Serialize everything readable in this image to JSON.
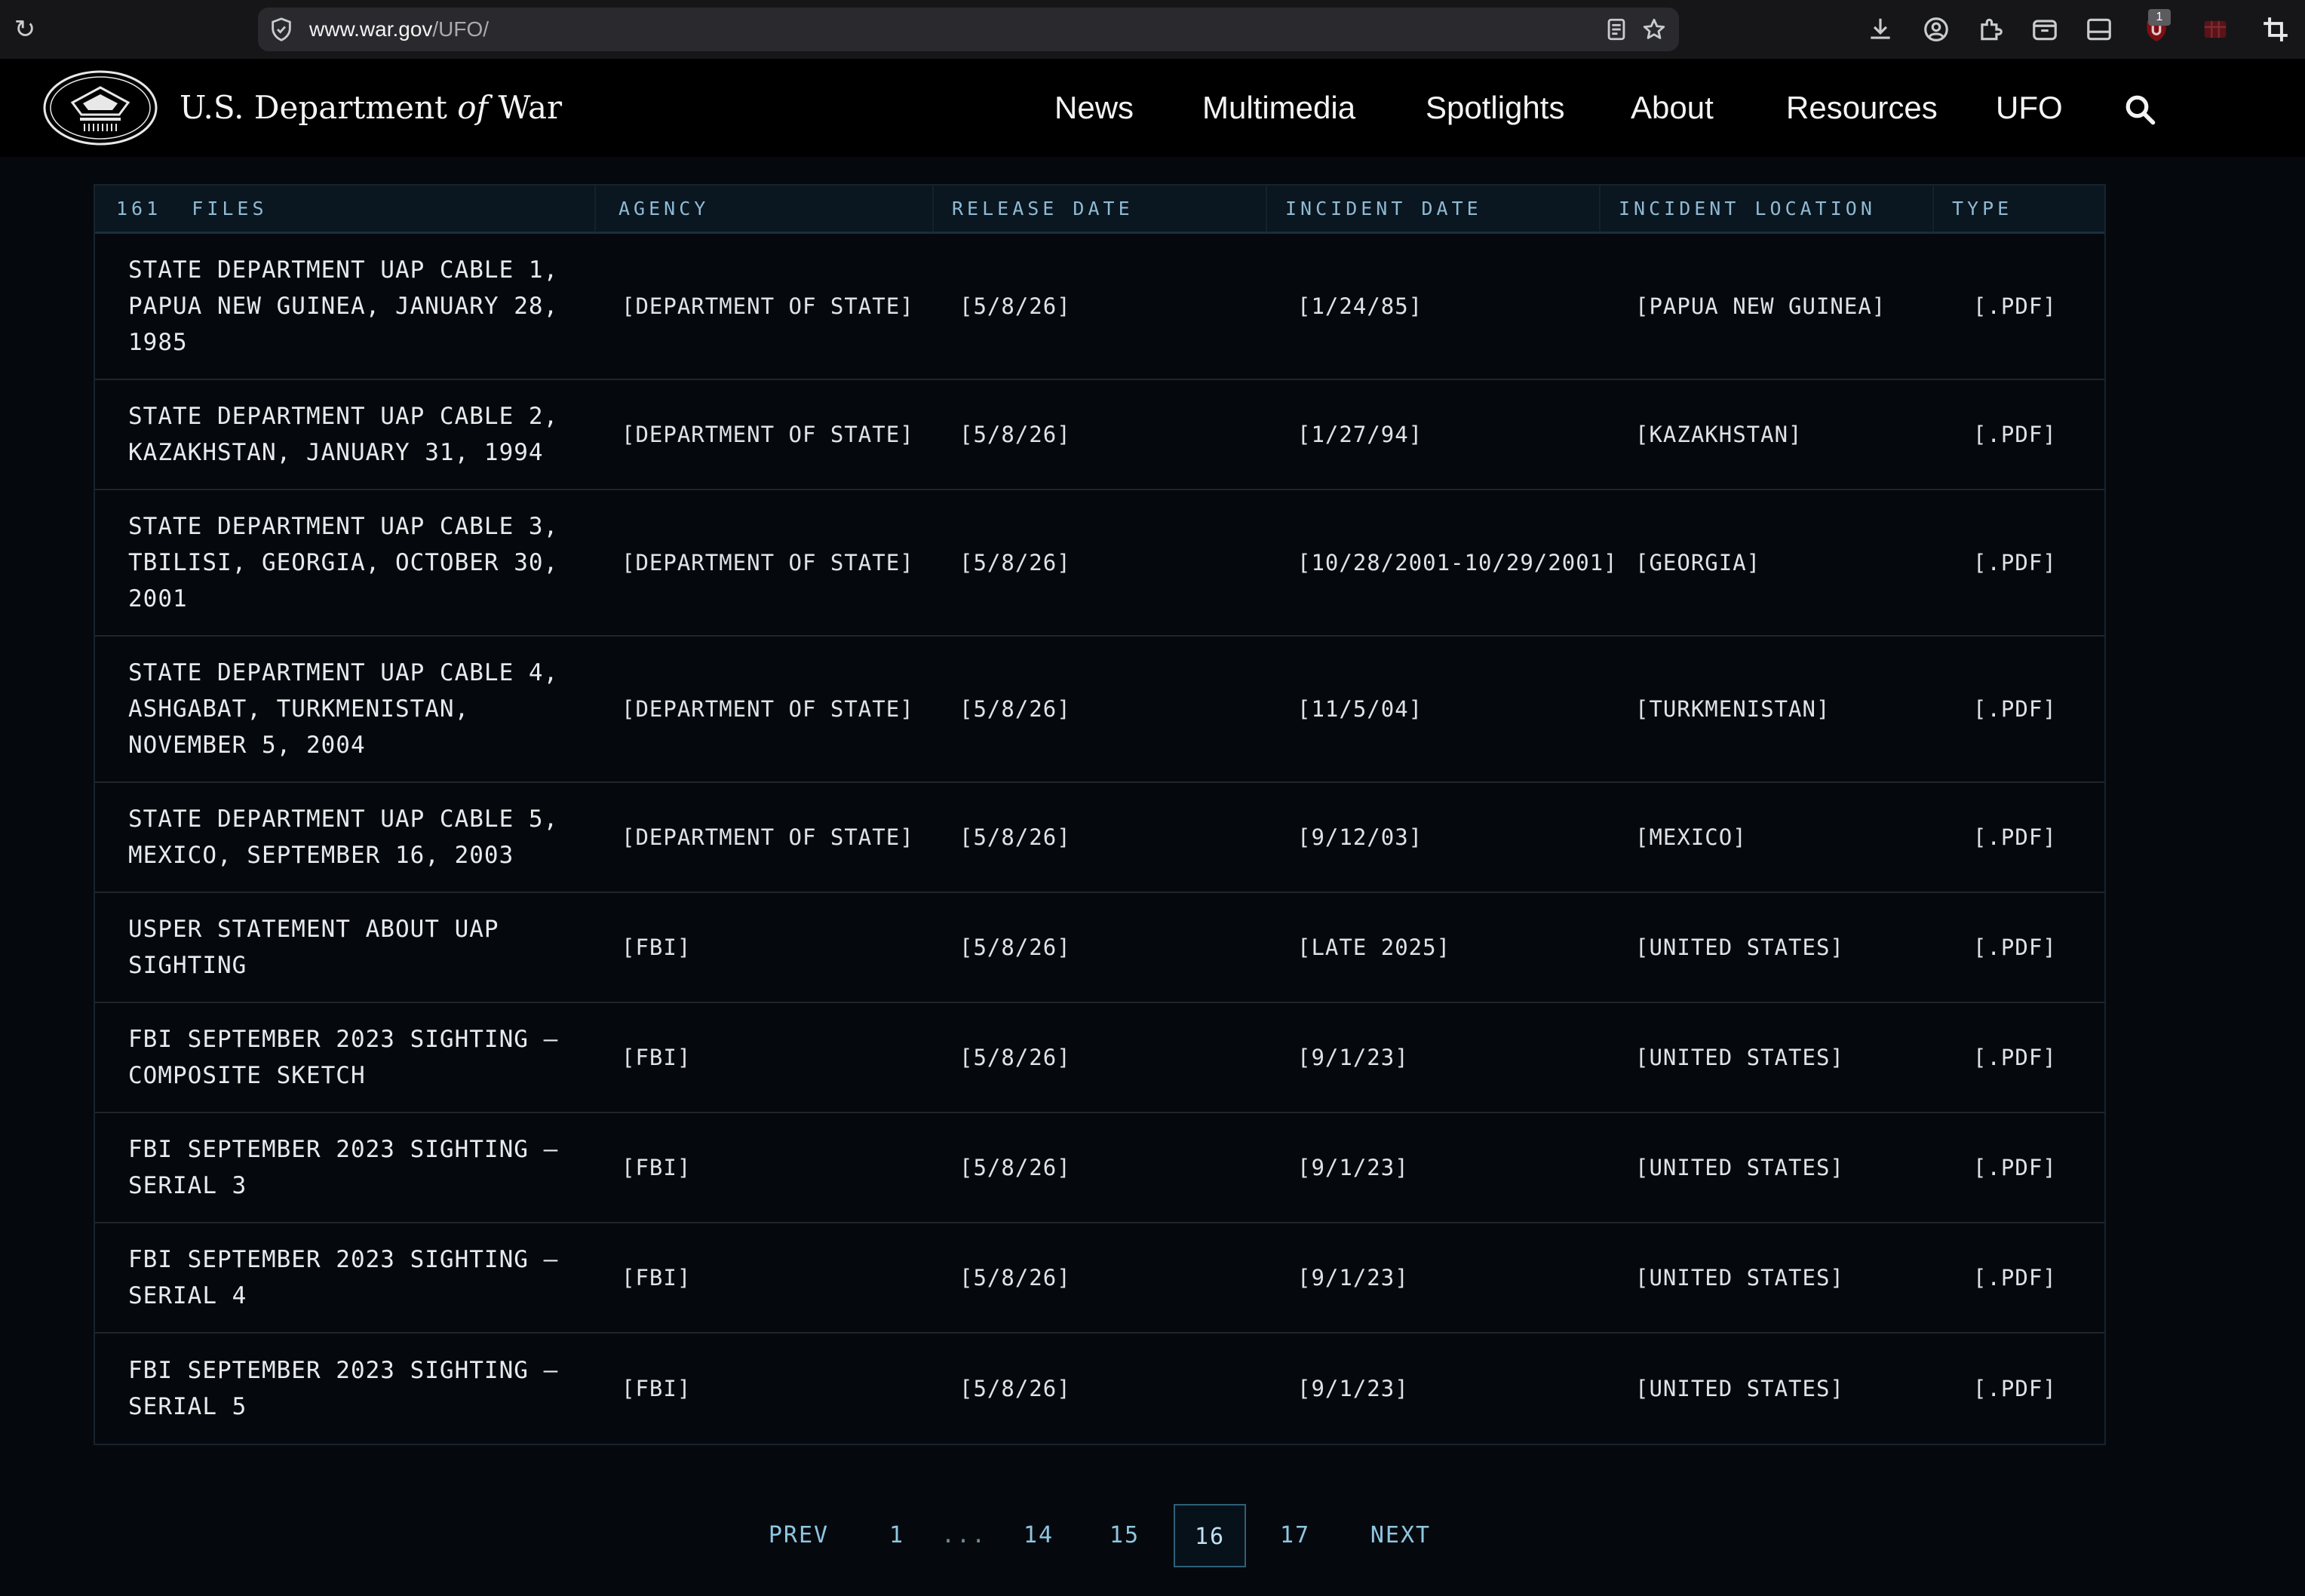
{
  "browser": {
    "url_host": "www.war.gov",
    "url_path": "/UFO/",
    "extension_badge": "1"
  },
  "site": {
    "title_part1": "U.S. Department ",
    "title_of": "of",
    "title_part2": " War",
    "nav": [
      "News",
      "Multimedia",
      "Spotlights",
      "About",
      "Resources",
      "UFO"
    ]
  },
  "table": {
    "headers": {
      "count": "161",
      "files": "FILES",
      "agency": "AGENCY",
      "release_date": "RELEASE DATE",
      "incident_date": "INCIDENT DATE",
      "incident_location": "INCIDENT LOCATION",
      "type": "TYPE"
    },
    "rows": [
      {
        "title": "STATE DEPARTMENT UAP CABLE 1, PAPUA NEW GUINEA, JANUARY 28, 1985",
        "agency": "[DEPARTMENT OF STATE]",
        "release": "[5/8/26]",
        "incident": "[1/24/85]",
        "location": "[PAPUA NEW GUINEA]",
        "type": "[.PDF]"
      },
      {
        "title": "STATE DEPARTMENT UAP CABLE 2, KAZAKHSTAN, JANUARY 31, 1994",
        "agency": "[DEPARTMENT OF STATE]",
        "release": "[5/8/26]",
        "incident": "[1/27/94]",
        "location": "[KAZAKHSTAN]",
        "type": "[.PDF]"
      },
      {
        "title": "STATE DEPARTMENT UAP CABLE 3, TBILISI, GEORGIA, OCTOBER 30, 2001",
        "agency": "[DEPARTMENT OF STATE]",
        "release": "[5/8/26]",
        "incident": "[10/28/2001-10/29/2001]",
        "location": "[GEORGIA]",
        "type": "[.PDF]"
      },
      {
        "title": "STATE DEPARTMENT UAP CABLE 4, ASHGABAT, TURKMENISTAN, NOVEMBER 5, 2004",
        "agency": "[DEPARTMENT OF STATE]",
        "release": "[5/8/26]",
        "incident": "[11/5/04]",
        "location": "[TURKMENISTAN]",
        "type": "[.PDF]"
      },
      {
        "title": "STATE DEPARTMENT UAP CABLE 5, MEXICO, SEPTEMBER 16, 2003",
        "agency": "[DEPARTMENT OF STATE]",
        "release": "[5/8/26]",
        "incident": "[9/12/03]",
        "location": "[MEXICO]",
        "type": "[.PDF]"
      },
      {
        "title": "USPER STATEMENT ABOUT UAP SIGHTING",
        "agency": "[FBI]",
        "release": "[5/8/26]",
        "incident": "[LATE 2025]",
        "location": "[UNITED STATES]",
        "type": "[.PDF]"
      },
      {
        "title": "FBI SEPTEMBER 2023 SIGHTING – COMPOSITE SKETCH",
        "agency": "[FBI]",
        "release": "[5/8/26]",
        "incident": "[9/1/23]",
        "location": "[UNITED STATES]",
        "type": "[.PDF]"
      },
      {
        "title": "FBI SEPTEMBER 2023 SIGHTING – SERIAL 3",
        "agency": "[FBI]",
        "release": "[5/8/26]",
        "incident": "[9/1/23]",
        "location": "[UNITED STATES]",
        "type": "[.PDF]"
      },
      {
        "title": "FBI SEPTEMBER 2023 SIGHTING – SERIAL 4",
        "agency": "[FBI]",
        "release": "[5/8/26]",
        "incident": "[9/1/23]",
        "location": "[UNITED STATES]",
        "type": "[.PDF]"
      },
      {
        "title": "FBI SEPTEMBER 2023 SIGHTING – SERIAL 5",
        "agency": "[FBI]",
        "release": "[5/8/26]",
        "incident": "[9/1/23]",
        "location": "[UNITED STATES]",
        "type": "[.PDF]"
      }
    ]
  },
  "pagination": {
    "prev": "PREV",
    "first": "1",
    "ellipsis": "...",
    "pages": [
      "14",
      "15",
      "16",
      "17"
    ],
    "current": "16",
    "next": "NEXT"
  }
}
